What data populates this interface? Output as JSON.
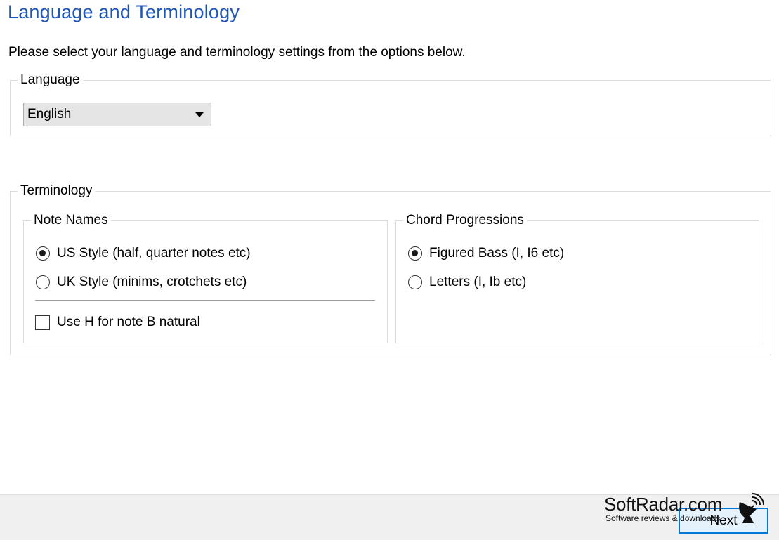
{
  "header": {
    "title": "Language and Terminology",
    "intro": "Please select your language and terminology settings from the options below."
  },
  "language": {
    "legend": "Language",
    "selected": "English"
  },
  "terminology": {
    "legend": "Terminology",
    "note_names": {
      "legend": "Note Names",
      "options": [
        {
          "label": "US Style (half, quarter notes etc)",
          "selected": true
        },
        {
          "label": "UK Style (minims, crotchets etc)",
          "selected": false
        }
      ],
      "checkbox": {
        "label": "Use H for note B natural",
        "checked": false
      }
    },
    "chord_progressions": {
      "legend": "Chord Progressions",
      "options": [
        {
          "label": "Figured Bass (I, I6 etc)",
          "selected": true
        },
        {
          "label": "Letters (I, Ib etc)",
          "selected": false
        }
      ]
    }
  },
  "footer": {
    "next_label": "Next"
  },
  "watermark": {
    "main": "SoftRadar.com",
    "sub": "Software reviews & downloads",
    "icon": "satellite-dish-icon"
  },
  "colors": {
    "title": "#1f57b8",
    "accent": "#0078d7",
    "footer_bg": "#f0f0f0"
  }
}
